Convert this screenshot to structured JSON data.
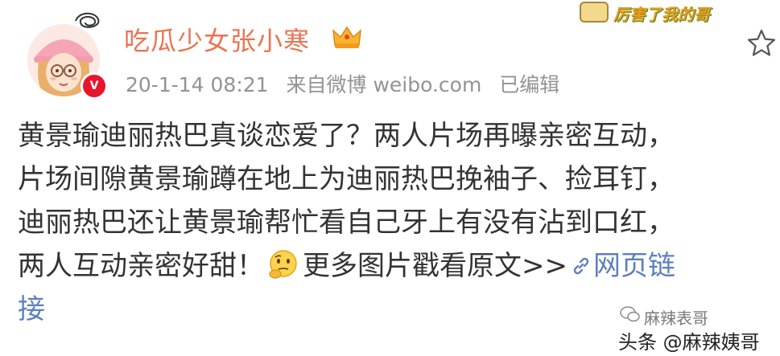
{
  "post": {
    "username": "吃瓜少女张小寒",
    "timestamp": "20-1-14 08:21",
    "source": "来自微博 weibo.com",
    "edited": "已编辑",
    "lines": [
      "黄景瑜迪丽热巴真谈恋爱了？两人片场再曝亲密互动，",
      "片场间隙黄景瑜蹲在地上为迪丽热巴挽袖子、捡耳钉，",
      "迪丽热巴还让黄景瑜帮忙看自己牙上有没有沾到口红，"
    ],
    "line4_text": "两人互动亲密好甜！",
    "more_link": "更多图片戳看原文>>",
    "web_link_part1": "网页链",
    "web_link_part2": "接"
  },
  "sticker": {
    "text": "厉害了我的哥"
  },
  "watermark": {
    "text": "麻辣表哥"
  },
  "source_tag": {
    "text": "头条 @麻辣姨哥"
  },
  "icons": {
    "favorite": "star-outline-icon",
    "verified": "verified-v-icon",
    "vip": "crown-icon",
    "emoji": "thinking-face-icon",
    "link": "link-icon",
    "watermark": "wechat-icon"
  },
  "colors": {
    "username": "#eb7350",
    "meta": "#939393",
    "body_text": "#333333",
    "link": "#5d7fbf",
    "verified": "#e6162d"
  }
}
